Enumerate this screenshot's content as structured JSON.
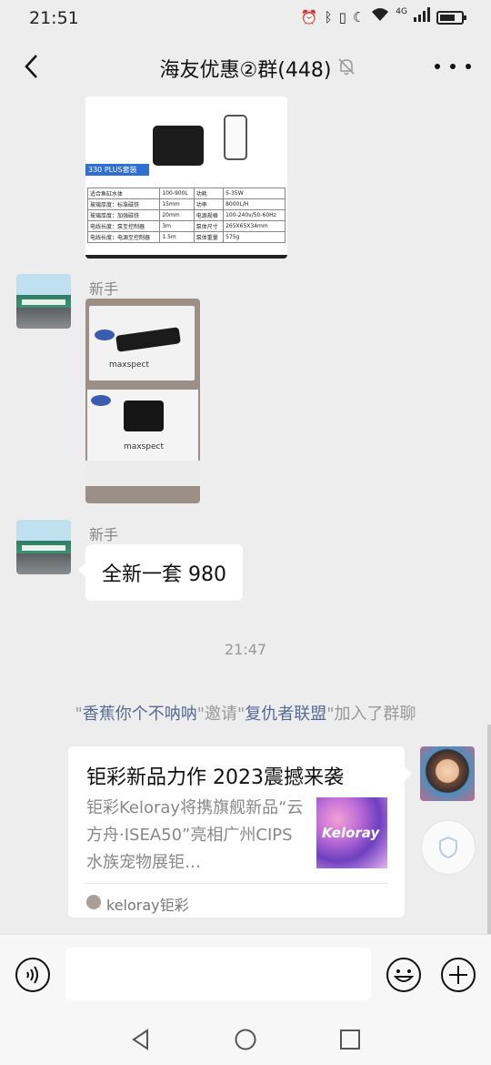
{
  "status_bar": {
    "time": "21:51",
    "network": "4G"
  },
  "header": {
    "title": "海友优惠②群(448)"
  },
  "product_image": {
    "label": "330 PLUS套装",
    "specs": [
      [
        "适合鱼缸水体",
        "100-900L",
        "功耗",
        "5-35W"
      ],
      [
        "玻璃厚度：标准磁铁",
        "15mm",
        "功率",
        "8000L/H"
      ],
      [
        "玻璃厚度：加强磁铁",
        "20mm",
        "电源规格",
        "100-240v/50-60Hz"
      ],
      [
        "电线长度：泵至控制器",
        "3m",
        "泵体尺寸",
        "265X65X34mm"
      ],
      [
        "电线长度：电源至控制器",
        "1.5m",
        "泵体重量",
        "575g"
      ]
    ]
  },
  "messages": [
    {
      "sender": "新手"
    },
    {
      "sender": "新手",
      "text": "全新一套 980"
    }
  ],
  "photo_text": {
    "brand": "maxspect"
  },
  "timestamp": "21:47",
  "system": {
    "q1": "\"",
    "inviter": "香蕉你个不呐呐",
    "q2": "\"邀请\"",
    "invitee": "复仇者联盟",
    "q3": "\"加入了群聊"
  },
  "link_card": {
    "title": "钜彩新品力作 2023震撼来袭",
    "description": "钜彩Keloray将携旗舰新品“云方舟·ISEA50”亮相广州CIPS水族宠物展钜…",
    "thumb_text": "Keloray",
    "source": "keloray钜彩"
  }
}
